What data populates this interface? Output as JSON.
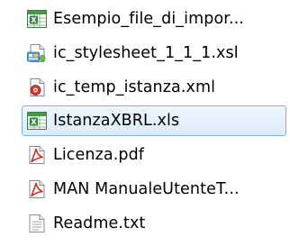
{
  "file_list": {
    "items": [
      {
        "name": "Esempio_file_di_impor...",
        "icon": "excel-file-icon"
      },
      {
        "name": "ic_stylesheet_1_1_1.xsl",
        "icon": "xsl-stylesheet-file-icon"
      },
      {
        "name": "ic_temp_istanza.xml",
        "icon": "xml-file-icon"
      },
      {
        "name": "IstanzaXBRL.xls",
        "icon": "excel-file-icon",
        "selected": true
      },
      {
        "name": "Licenza.pdf",
        "icon": "pdf-file-icon"
      },
      {
        "name": "MAN ManualeUtenteT...",
        "icon": "pdf-file-icon"
      },
      {
        "name": "Readme.txt",
        "icon": "text-file-icon"
      }
    ]
  },
  "colors": {
    "selection_fill": "#dcecfc",
    "selection_border": "#7eb4ea",
    "excel_green": "#2e8b3e",
    "pdf_red": "#d42a1f",
    "xml_red": "#c62828"
  }
}
